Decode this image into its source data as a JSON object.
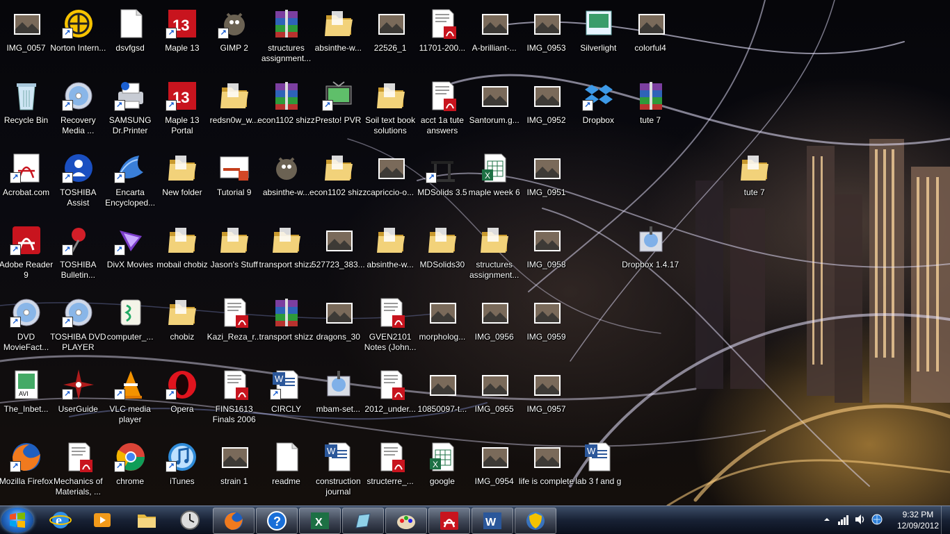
{
  "icons": [
    {
      "label": "IMG_0057",
      "type": "photo",
      "col": 0,
      "row": 0
    },
    {
      "label": "Norton Intern...",
      "type": "norton",
      "col": 1,
      "row": 0,
      "shortcut": true
    },
    {
      "label": "dsvfgsd",
      "type": "textfile",
      "col": 2,
      "row": 0
    },
    {
      "label": "Maple 13",
      "type": "maple",
      "col": 3,
      "row": 0,
      "shortcut": true
    },
    {
      "label": "GIMP 2",
      "type": "gimp",
      "col": 4,
      "row": 0,
      "shortcut": true
    },
    {
      "label": "structures assignment...",
      "type": "winrar",
      "col": 5,
      "row": 0
    },
    {
      "label": "absinthe-w...",
      "type": "folder",
      "col": 6,
      "row": 0
    },
    {
      "label": "22526_1",
      "type": "photo",
      "col": 7,
      "row": 0
    },
    {
      "label": "11701-200...",
      "type": "pdf",
      "col": 8,
      "row": 0
    },
    {
      "label": "A-brilliant-...",
      "type": "photo",
      "col": 9,
      "row": 0
    },
    {
      "label": "IMG_0953",
      "type": "photo",
      "col": 10,
      "row": 0
    },
    {
      "label": "Silverlight",
      "type": "doc",
      "col": 11,
      "row": 0
    },
    {
      "label": "colorful4",
      "type": "photo",
      "col": 12,
      "row": 0
    },
    {
      "label": "Recycle Bin",
      "type": "recycle",
      "col": 0,
      "row": 1
    },
    {
      "label": "Recovery Media ...",
      "type": "disc",
      "col": 1,
      "row": 1,
      "shortcut": true
    },
    {
      "label": "SAMSUNG Dr.Printer",
      "type": "printer",
      "col": 2,
      "row": 1,
      "shortcut": true
    },
    {
      "label": "Maple 13 Portal",
      "type": "maple",
      "col": 3,
      "row": 1,
      "shortcut": true
    },
    {
      "label": "redsn0w_w...",
      "type": "folder",
      "col": 4,
      "row": 1
    },
    {
      "label": "econ1102 shizz",
      "type": "winrar",
      "col": 5,
      "row": 1
    },
    {
      "label": "Presto! PVR",
      "type": "tv",
      "col": 6,
      "row": 1,
      "shortcut": true
    },
    {
      "label": "Soil text book solutions",
      "type": "folder",
      "col": 7,
      "row": 1
    },
    {
      "label": "acct 1a tute answers",
      "type": "pdf",
      "col": 8,
      "row": 1
    },
    {
      "label": "Santorum.g...",
      "type": "photo",
      "col": 9,
      "row": 1
    },
    {
      "label": "IMG_0952",
      "type": "photo",
      "col": 10,
      "row": 1
    },
    {
      "label": "Dropbox",
      "type": "dropbox",
      "col": 11,
      "row": 1,
      "shortcut": true
    },
    {
      "label": "tute 7",
      "type": "winrar",
      "col": 12,
      "row": 1
    },
    {
      "label": "Acrobat.com",
      "type": "acrobat",
      "col": 0,
      "row": 2,
      "shortcut": true
    },
    {
      "label": "TOSHIBA Assist",
      "type": "assist",
      "col": 1,
      "row": 2,
      "shortcut": true
    },
    {
      "label": "Encarta Encycloped...",
      "type": "encarta",
      "col": 2,
      "row": 2,
      "shortcut": true
    },
    {
      "label": "New folder",
      "type": "folder",
      "col": 3,
      "row": 2
    },
    {
      "label": "Tutorial 9",
      "type": "ppt",
      "col": 4,
      "row": 2
    },
    {
      "label": "absinthe-w...",
      "type": "gimp",
      "col": 5,
      "row": 2
    },
    {
      "label": "econ1102 shizz",
      "type": "folder",
      "col": 6,
      "row": 2
    },
    {
      "label": "capriccio-o...",
      "type": "photo",
      "col": 7,
      "row": 2
    },
    {
      "label": "MDSolids 3.5",
      "type": "mdsolids",
      "col": 8,
      "row": 2,
      "shortcut": true
    },
    {
      "label": "maple week 6",
      "type": "excel",
      "col": 9,
      "row": 2
    },
    {
      "label": "IMG_0951",
      "type": "photo",
      "col": 10,
      "row": 2
    },
    {
      "label": "tute 7",
      "type": "folder",
      "col": 14,
      "row": 2
    },
    {
      "label": "Adobe Reader 9",
      "type": "pdfapp",
      "col": 0,
      "row": 3,
      "shortcut": true
    },
    {
      "label": "TOSHIBA Bulletin...",
      "type": "pin",
      "col": 1,
      "row": 3,
      "shortcut": true
    },
    {
      "label": "DivX Movies",
      "type": "divx",
      "col": 2,
      "row": 3,
      "shortcut": true
    },
    {
      "label": "mobail chobiz",
      "type": "folder",
      "col": 3,
      "row": 3
    },
    {
      "label": "Jason's Stuff",
      "type": "folder",
      "col": 4,
      "row": 3
    },
    {
      "label": "transport shizz",
      "type": "folder",
      "col": 5,
      "row": 3
    },
    {
      "label": "527723_383...",
      "type": "photo",
      "col": 6,
      "row": 3
    },
    {
      "label": "absinthe-w...",
      "type": "folder",
      "col": 7,
      "row": 3
    },
    {
      "label": "MDSolids30",
      "type": "folder",
      "col": 8,
      "row": 3
    },
    {
      "label": "structures assignment...",
      "type": "folder",
      "col": 9,
      "row": 3
    },
    {
      "label": "IMG_0958",
      "type": "photo",
      "col": 10,
      "row": 3
    },
    {
      "label": "Dropbox 1.4.17",
      "type": "setup",
      "col": 12,
      "row": 3
    },
    {
      "label": "DVD MovieFact...",
      "type": "disc",
      "col": 0,
      "row": 4,
      "shortcut": true
    },
    {
      "label": "TOSHIBA DVD PLAYER",
      "type": "disc",
      "col": 1,
      "row": 4,
      "shortcut": true
    },
    {
      "label": "computer_...",
      "type": "script",
      "col": 2,
      "row": 4
    },
    {
      "label": "chobiz",
      "type": "folder",
      "col": 3,
      "row": 4
    },
    {
      "label": "Kazi_Reza_r...",
      "type": "pdf",
      "col": 4,
      "row": 4
    },
    {
      "label": "transport shizz",
      "type": "winrar",
      "col": 5,
      "row": 4
    },
    {
      "label": "dragons_30",
      "type": "photo",
      "col": 6,
      "row": 4
    },
    {
      "label": "GVEN2101 Notes (John...",
      "type": "pdf",
      "col": 7,
      "row": 4
    },
    {
      "label": "morpholog...",
      "type": "photo",
      "col": 8,
      "row": 4
    },
    {
      "label": "IMG_0956",
      "type": "photo",
      "col": 9,
      "row": 4
    },
    {
      "label": "IMG_0959",
      "type": "photo",
      "col": 10,
      "row": 4
    },
    {
      "label": "The_Inbet...",
      "type": "avi",
      "col": 0,
      "row": 5
    },
    {
      "label": "UserGuide",
      "type": "compass",
      "col": 1,
      "row": 5,
      "shortcut": true
    },
    {
      "label": "VLC media player",
      "type": "vlc",
      "col": 2,
      "row": 5,
      "shortcut": true
    },
    {
      "label": "Opera",
      "type": "opera",
      "col": 3,
      "row": 5,
      "shortcut": true
    },
    {
      "label": "FINS1613 Finals 2006",
      "type": "pdf",
      "col": 4,
      "row": 5
    },
    {
      "label": "CIRCLY",
      "type": "word",
      "col": 5,
      "row": 5,
      "shortcut": true
    },
    {
      "label": "mbam-set...",
      "type": "setup",
      "col": 6,
      "row": 5
    },
    {
      "label": "2012_under...",
      "type": "pdf",
      "col": 7,
      "row": 5
    },
    {
      "label": "10850097-t...",
      "type": "photo",
      "col": 8,
      "row": 5
    },
    {
      "label": "IMG_0955",
      "type": "photo",
      "col": 9,
      "row": 5
    },
    {
      "label": "IMG_0957",
      "type": "photo",
      "col": 10,
      "row": 5
    },
    {
      "label": "Mozilla Firefox",
      "type": "firefox",
      "col": 0,
      "row": 6,
      "shortcut": true
    },
    {
      "label": "Mechanics of Materials, ...",
      "type": "pdf",
      "col": 1,
      "row": 6
    },
    {
      "label": "chrome",
      "type": "chrome",
      "col": 2,
      "row": 6,
      "shortcut": true
    },
    {
      "label": "iTunes",
      "type": "itunes",
      "col": 3,
      "row": 6,
      "shortcut": true
    },
    {
      "label": "strain 1",
      "type": "photo",
      "col": 4,
      "row": 6
    },
    {
      "label": "readme",
      "type": "textfile",
      "col": 5,
      "row": 6
    },
    {
      "label": "construction journal",
      "type": "word",
      "col": 6,
      "row": 6
    },
    {
      "label": "structerre_...",
      "type": "pdf",
      "col": 7,
      "row": 6
    },
    {
      "label": "google",
      "type": "excel",
      "col": 8,
      "row": 6
    },
    {
      "label": "IMG_0954",
      "type": "photo",
      "col": 9,
      "row": 6
    },
    {
      "label": "life is complete",
      "type": "photo",
      "col": 10,
      "row": 6
    },
    {
      "label": "lab 3 f and g",
      "type": "word",
      "col": 11,
      "row": 6
    }
  ],
  "taskbar": {
    "start_icon": "windows-orb-icon",
    "pinned": [
      {
        "name": "internet-explorer",
        "icon": "ie-icon"
      },
      {
        "name": "media-player",
        "icon": "media-player-icon"
      },
      {
        "name": "explorer",
        "icon": "folder-icon"
      },
      {
        "name": "clock-app",
        "icon": "clock-icon"
      },
      {
        "name": "firefox",
        "icon": "firefox-icon",
        "active": true
      },
      {
        "name": "help",
        "icon": "help-icon",
        "active": true
      },
      {
        "name": "excel",
        "icon": "excel-icon",
        "active": true
      },
      {
        "name": "notepad",
        "icon": "pen-icon",
        "active": true
      },
      {
        "name": "paint",
        "icon": "paint-icon",
        "active": true
      },
      {
        "name": "adobe-reader",
        "icon": "pdf-icon",
        "active": true
      },
      {
        "name": "word",
        "icon": "word-icon",
        "active": true
      },
      {
        "name": "control-panel",
        "icon": "shield-icon",
        "active": true
      }
    ],
    "tray_icons": [
      "arrow-up-icon",
      "signal-icon",
      "volume-icon",
      "network-icon"
    ],
    "clock_time": "9:32 PM",
    "clock_date": "12/09/2012"
  }
}
